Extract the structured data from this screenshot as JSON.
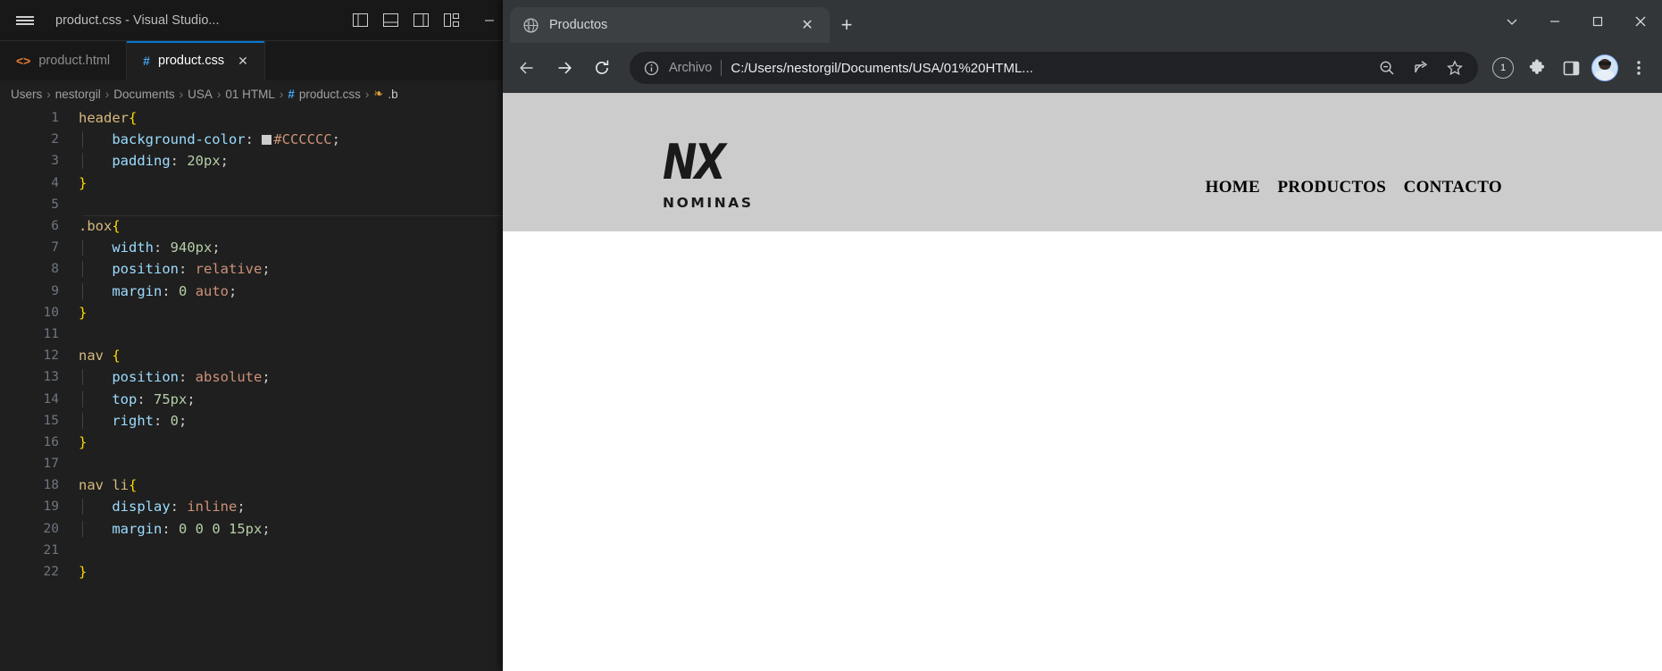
{
  "vscode": {
    "window_title": "product.css - Visual Studio...",
    "hamburger_icon": "menu-icon",
    "layout_icons": [
      "toggle-primary-sidebar-icon",
      "toggle-panel-icon",
      "toggle-secondary-sidebar-icon",
      "customize-layout-icon"
    ],
    "window_controls": [
      "minimize",
      "maximize",
      "close"
    ],
    "tabs": [
      {
        "label": "product.html",
        "icon": "html-file-icon",
        "active": false,
        "closable": false
      },
      {
        "label": "product.css",
        "icon": "css-file-icon",
        "active": true,
        "closable": true
      }
    ],
    "tab_actions": [
      "split-editor-icon",
      "more-actions-icon"
    ],
    "breadcrumb": [
      "Users",
      "nestorgil",
      "Documents",
      "USA",
      "01 HTML",
      "product.css",
      ".b"
    ],
    "breadcrumb_file_icon": "css-hash-icon",
    "breadcrumb_symbol_icon": "css-selector-icon",
    "code_lines": [
      {
        "n": "1",
        "text": "header{"
      },
      {
        "n": "2",
        "text": "    background-color: #CCCCCC;"
      },
      {
        "n": "3",
        "text": "    padding: 20px;"
      },
      {
        "n": "4",
        "text": "}"
      },
      {
        "n": "5",
        "text": ""
      },
      {
        "n": "6",
        "text": ".box{"
      },
      {
        "n": "7",
        "text": "    width: 940px;"
      },
      {
        "n": "8",
        "text": "    position: relative;"
      },
      {
        "n": "9",
        "text": "    margin: 0 auto;"
      },
      {
        "n": "10",
        "text": "}"
      },
      {
        "n": "11",
        "text": ""
      },
      {
        "n": "12",
        "text": "nav {"
      },
      {
        "n": "13",
        "text": "    position: absolute;"
      },
      {
        "n": "14",
        "text": "    top: 75px;"
      },
      {
        "n": "15",
        "text": "    right: 0;"
      },
      {
        "n": "16",
        "text": "}"
      },
      {
        "n": "17",
        "text": ""
      },
      {
        "n": "18",
        "text": "nav li{"
      },
      {
        "n": "19",
        "text": "    display: inline;"
      },
      {
        "n": "20",
        "text": "    margin: 0 0 0 15px;"
      },
      {
        "n": "21",
        "text": ""
      },
      {
        "n": "22",
        "text": "}"
      }
    ],
    "color_swatch": "#CCCCCC"
  },
  "browser": {
    "tab": {
      "title": "Productos",
      "favicon": "globe-icon",
      "close_icon": "close-icon"
    },
    "new_tab_label": "+",
    "window_controls": [
      "chevron-down-icon",
      "minimize-icon",
      "maximize-icon",
      "close-icon"
    ],
    "nav": {
      "back": "back-arrow-icon",
      "forward": "forward-arrow-icon",
      "reload": "reload-icon"
    },
    "omnibox": {
      "info_icon": "info-circle-icon",
      "scheme_label": "Archivo",
      "url": "C:/Users/nestorgil/Documents/USA/01%20HTML...",
      "zoom_icon": "zoom-out-icon",
      "share_icon": "share-icon",
      "bookmark_icon": "star-icon"
    },
    "actions": {
      "badge_count": "1",
      "extensions_icon": "puzzle-icon",
      "sidebar_icon": "side-panel-icon",
      "profile_icon": "avatar",
      "menu_icon": "three-dot-menu-icon"
    }
  },
  "page": {
    "logo": {
      "mark": "NX",
      "subtitle": "NOMINAS"
    },
    "nav_links": [
      "HOME",
      "PRODUCTOS",
      "CONTACTO"
    ],
    "header_bg": "#CCCCCC",
    "body_bg": "#FFFFFF"
  }
}
